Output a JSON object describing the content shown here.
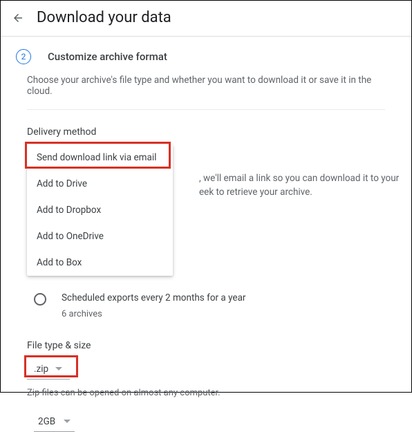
{
  "header": {
    "title": "Download your data"
  },
  "step": {
    "number": "2",
    "title": "Customize archive format"
  },
  "intro": "Choose your archive's file type and whether you want to download it or save it in the cloud.",
  "delivery": {
    "label": "Delivery method",
    "options": [
      "Send download link via email",
      "Add to Drive",
      "Add to Dropbox",
      "Add to OneDrive",
      "Add to Box"
    ],
    "reveal_text_r1": ", we'll email a link so you can download it to your",
    "reveal_text_r2": "eek to retrieve your archive."
  },
  "frequency": {
    "option_label": "Scheduled exports every 2 months for a year",
    "option_sub": "6 archives"
  },
  "filetype": {
    "label": "File type & size",
    "selected": ".zip",
    "hint": "Zip files can be opened on almost any computer.",
    "size_selected": "2GB"
  }
}
